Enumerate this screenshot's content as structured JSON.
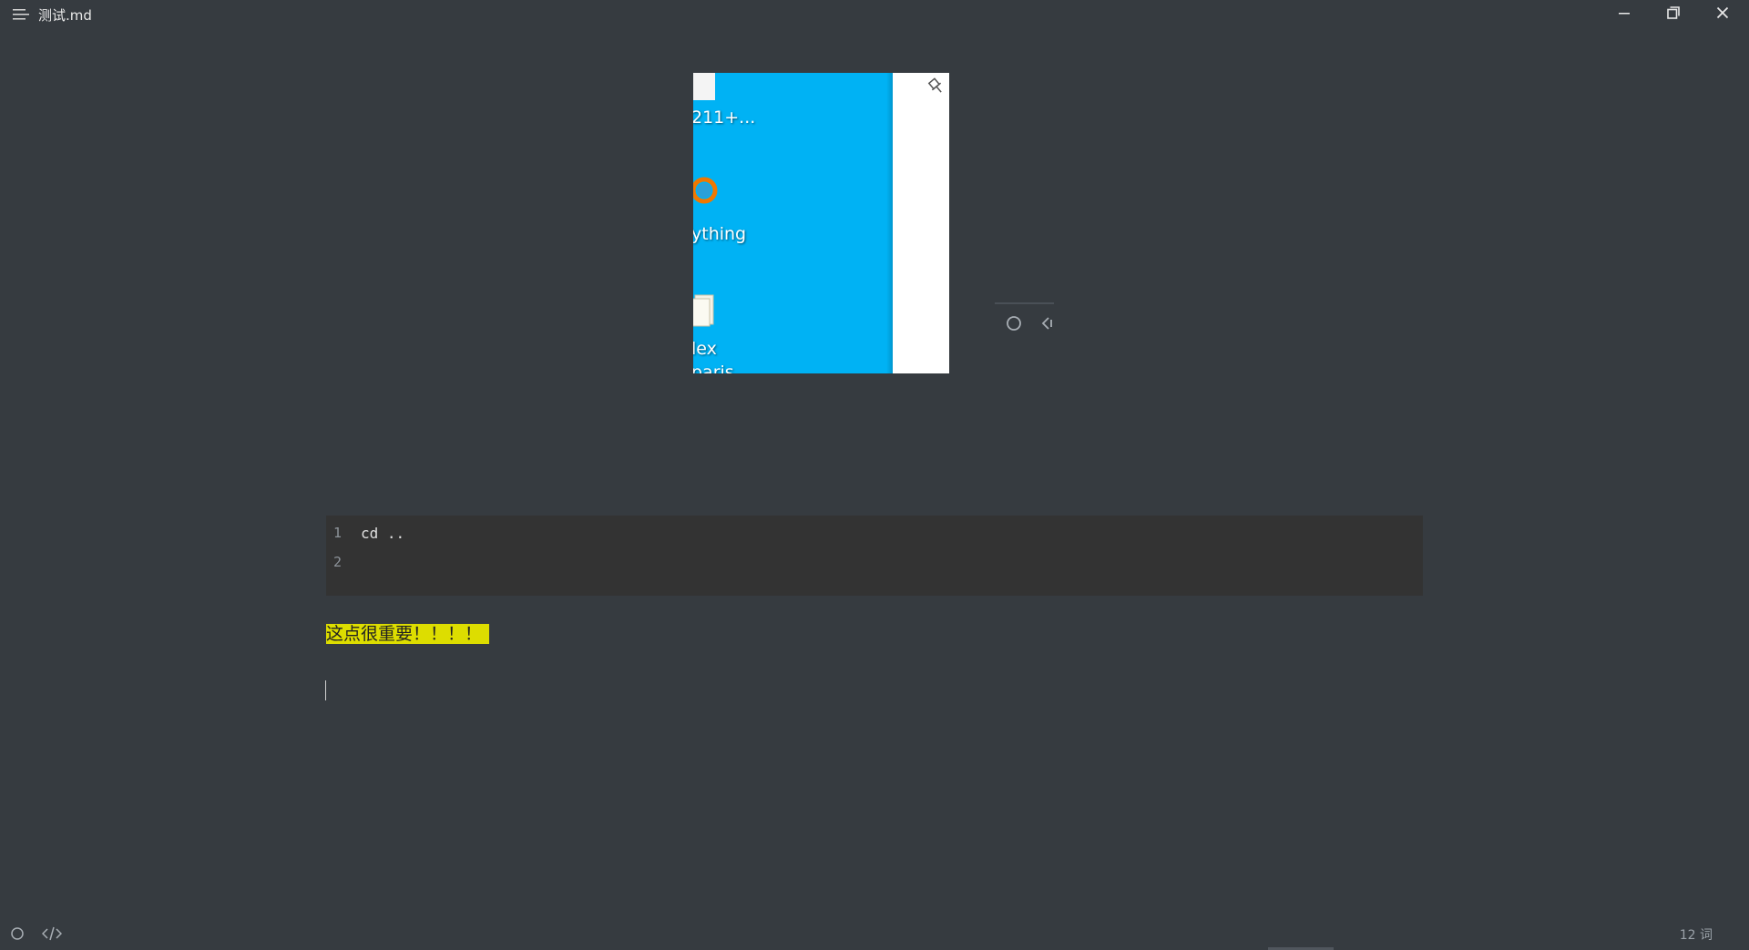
{
  "window": {
    "title": "测试.md"
  },
  "image_block": {
    "desktop_labels": [
      "211+...",
      "ything",
      "lex",
      "paris"
    ]
  },
  "code_block": {
    "lines": [
      {
        "number": "1",
        "code": "cd .."
      },
      {
        "number": "2",
        "code": ""
      }
    ]
  },
  "content": {
    "highlighted_text": "这点很重要！！！！"
  },
  "statusbar": {
    "word_count": "12 词"
  },
  "colors": {
    "background": "#363b40",
    "highlight": "#dddd00",
    "code_background": "#333333",
    "image_sky": "#00b2f4",
    "ring_orange": "#f07800"
  },
  "icons": {
    "menu": "menu-icon",
    "minimize": "minimize-icon",
    "maximize": "restore-icon",
    "close": "close-icon",
    "pin": "pin-icon",
    "circle": "circle-icon",
    "align": "align-icon",
    "source": "code-icon"
  }
}
